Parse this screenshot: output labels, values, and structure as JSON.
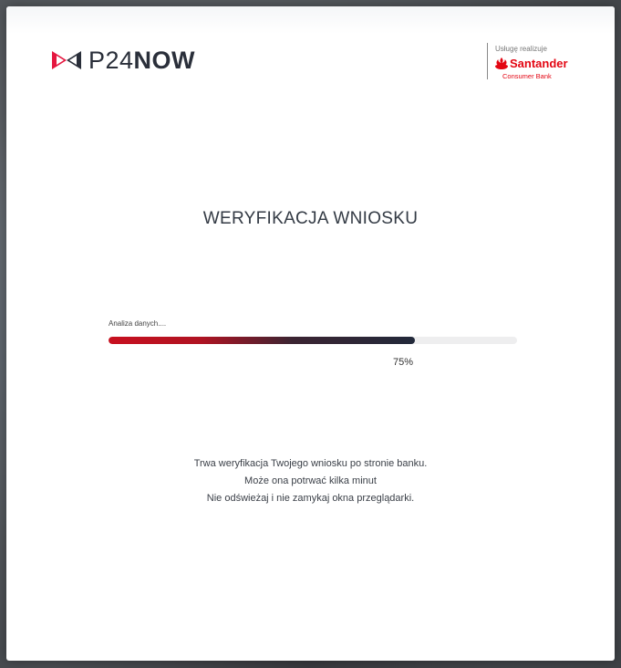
{
  "brand": {
    "logo_thin": "P24",
    "logo_bold": "NOW",
    "icon": "p24-bowtie-icon",
    "color_red": "#e5173f",
    "color_navy": "#2a2f3a"
  },
  "bank": {
    "caption": "Usługę realizuje",
    "name": "Santander",
    "subtitle": "Consumer Bank",
    "icon": "santander-flame-icon",
    "color": "#e30613"
  },
  "title": "WERYFIKACJA WNIOSKU",
  "progress": {
    "label": "Analiza danych....",
    "value": 0.75,
    "percent_text": "75%",
    "fill_start_color": "#c8101f",
    "fill_end_color": "#22293a"
  },
  "message": {
    "line1": "Trwa weryfikacja Twojego wniosku po stronie banku.",
    "line2": "Może ona potrwać kilka minut",
    "line3": "Nie odświeżaj i nie zamykaj okna przeglądarki."
  }
}
